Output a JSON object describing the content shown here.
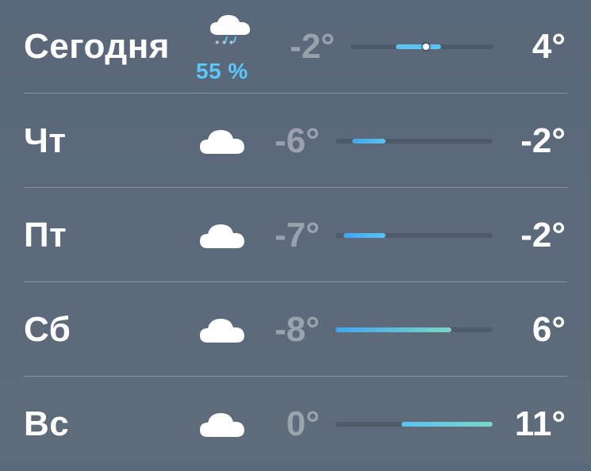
{
  "colors": {
    "precip": "#5ac8fa",
    "bar_cold": "#3fa6f0",
    "bar_cool": "#5cc2f0",
    "bar_mild": "#7ad6c6"
  },
  "days": [
    {
      "name": "Сегодня",
      "icon": "snow-cloud-icon",
      "precip": "55 %",
      "low": "-2°",
      "high": "4°",
      "low_value": -2,
      "high_value": 4,
      "current_value": 2
    },
    {
      "name": "Чт",
      "icon": "cloud-icon",
      "low": "-6°",
      "high": "-2°",
      "low_value": -6,
      "high_value": -2
    },
    {
      "name": "Пт",
      "icon": "cloud-icon",
      "low": "-7°",
      "high": "-2°",
      "low_value": -7,
      "high_value": -2
    },
    {
      "name": "Сб",
      "icon": "cloud-icon",
      "low": "-8°",
      "high": "6°",
      "low_value": -8,
      "high_value": 6
    },
    {
      "name": "Вс",
      "icon": "cloud-icon",
      "low": "0°",
      "high": "11°",
      "low_value": 0,
      "high_value": 11
    }
  ]
}
